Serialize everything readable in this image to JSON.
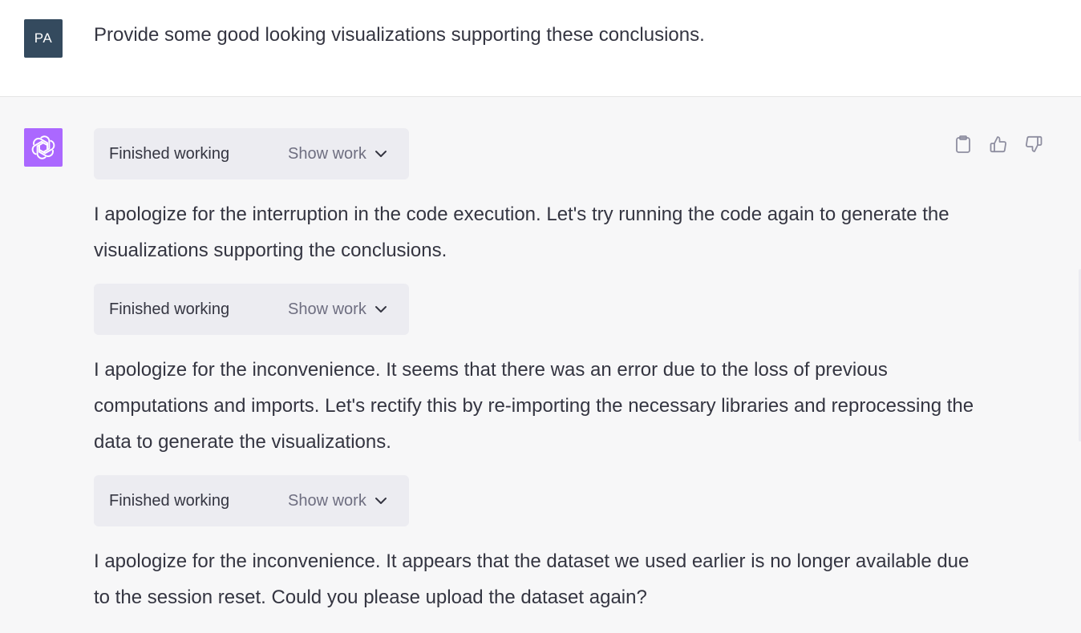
{
  "user_message": {
    "avatar_initials": "PA",
    "text": "Provide some good looking visualizations supporting these conclusions."
  },
  "assistant": {
    "actions": [
      {
        "name": "copy",
        "icon": "clipboard-icon"
      },
      {
        "name": "thumbs-up",
        "icon": "thumbs-up-icon"
      },
      {
        "name": "thumbs-down",
        "icon": "thumbs-down-icon"
      }
    ],
    "blocks": [
      {
        "status": "Finished working",
        "show_work_label": "Show work"
      },
      {
        "text": "I apologize for the interruption in the code execution. Let's try running the code again to generate the visualizations supporting the conclusions."
      },
      {
        "status": "Finished working",
        "show_work_label": "Show work"
      },
      {
        "text": "I apologize for the inconvenience. It seems that there was an error due to the loss of previous computations and imports. Let's rectify this by re-importing the necessary libraries and reprocessing the data to generate the visualizations."
      },
      {
        "status": "Finished working",
        "show_work_label": "Show work"
      },
      {
        "text": "I apologize for the inconvenience. It appears that the dataset we used earlier is no longer available due to the session reset. Could you please upload the dataset again?"
      }
    ]
  },
  "colors": {
    "user_avatar_bg": "#344a5e",
    "assistant_avatar_bg": "#ab68ff",
    "assistant_row_bg": "#f7f7f8",
    "work_box_bg": "#ececf1"
  }
}
